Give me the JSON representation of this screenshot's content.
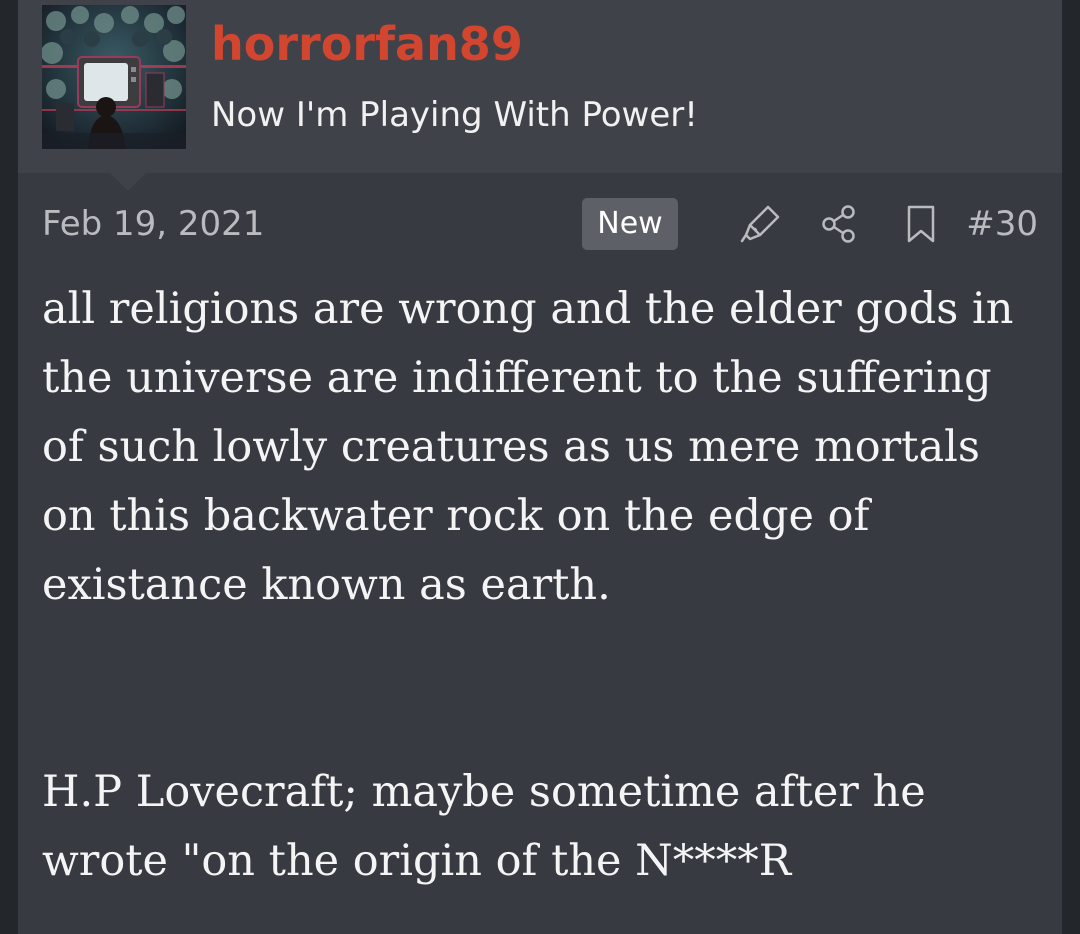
{
  "post": {
    "author": {
      "username": "horrorfan89",
      "user_title": "Now I'm Playing With Power!",
      "avatar_icon": "avatar-image",
      "username_color": "#d2452f"
    },
    "meta": {
      "date": "Feb 19, 2021",
      "badge": "New",
      "icons": [
        "highlighter-icon",
        "share-icon",
        "bookmark-icon"
      ],
      "post_number": "#30"
    },
    "body": {
      "paragraph_1": "all religions are wrong and the elder gods in the universe are indifferent to the suffering of such lowly creatures as us mere mortals on this backwater rock on the edge of existance known as earth.",
      "paragraph_2": "H.P Lovecraft; maybe sometime after he wrote \"on the origin of the N****R"
    }
  }
}
